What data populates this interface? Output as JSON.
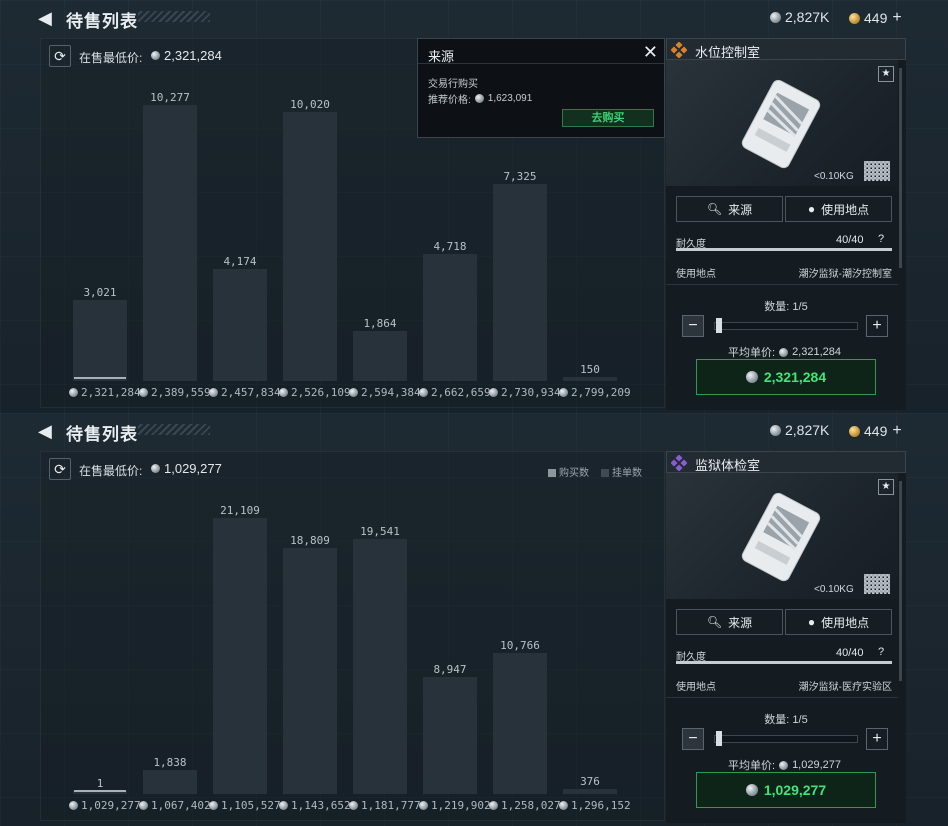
{
  "panels": [
    {
      "title": "待售列表",
      "currency_silver": "2,827K",
      "currency_gold": "449",
      "min_label": "在售最低价:",
      "min_value": "2,321,284",
      "legend": null,
      "popup": {
        "title": "来源",
        "source": "交易行购买",
        "price_label": "推荐价格:",
        "price_value": "1,623,091",
        "buy_label": "去购买"
      },
      "item": {
        "name": "水位控制室",
        "rank_color": "#d9822b",
        "weight": "<0.10KG",
        "src_btn": "来源",
        "loc_btn": "使用地点",
        "durability_label": "耐久度",
        "durability_value": "40/40",
        "durability_help": "?",
        "location_label": "使用地点",
        "location_value": "潮汐监狱-潮汐控制室",
        "qty_label": "数量: 1/5",
        "avg_label": "平均单价:",
        "avg_value": "2,321,284",
        "buy_value": "2,321,284"
      },
      "chart_data": {
        "type": "bar",
        "categories": [
          "2,321,284",
          "2,389,559",
          "2,457,834",
          "2,526,109",
          "2,594,384",
          "2,662,659",
          "2,730,934",
          "2,799,209"
        ],
        "values": [
          3021,
          10277,
          4174,
          10020,
          1864,
          4718,
          7325,
          150
        ],
        "labels": [
          "3,021",
          "10,277",
          "4,174",
          "10,020",
          "1,864",
          "4,718",
          "7,325",
          "150"
        ],
        "ylim": [
          0,
          10277
        ]
      }
    },
    {
      "title": "待售列表",
      "currency_silver": "2,827K",
      "currency_gold": "449",
      "min_label": "在售最低价:",
      "min_value": "1,029,277",
      "legend": {
        "buy": "购买数",
        "sell": "挂单数"
      },
      "popup": null,
      "item": {
        "name": "监狱体检室",
        "rank_color": "#8a5bd6",
        "weight": "<0.10KG",
        "src_btn": "来源",
        "loc_btn": "使用地点",
        "durability_label": "耐久度",
        "durability_value": "40/40",
        "durability_help": "?",
        "location_label": "使用地点",
        "location_value": "潮汐监狱-医疗实验区",
        "qty_label": "数量: 1/5",
        "avg_label": "平均单价:",
        "avg_value": "1,029,277",
        "buy_value": "1,029,277"
      },
      "chart_data": {
        "type": "bar",
        "categories": [
          "1,029,277",
          "1,067,402",
          "1,105,527",
          "1,143,652",
          "1,181,777",
          "1,219,902",
          "1,258,027",
          "1,296,152"
        ],
        "values": [
          1,
          1838,
          21109,
          18809,
          19541,
          8947,
          10766,
          376
        ],
        "labels": [
          "1",
          "1,838",
          "21,109",
          "18,809",
          "19,541",
          "8,947",
          "10,766",
          "376"
        ],
        "ylim": [
          0,
          21109
        ]
      }
    }
  ]
}
